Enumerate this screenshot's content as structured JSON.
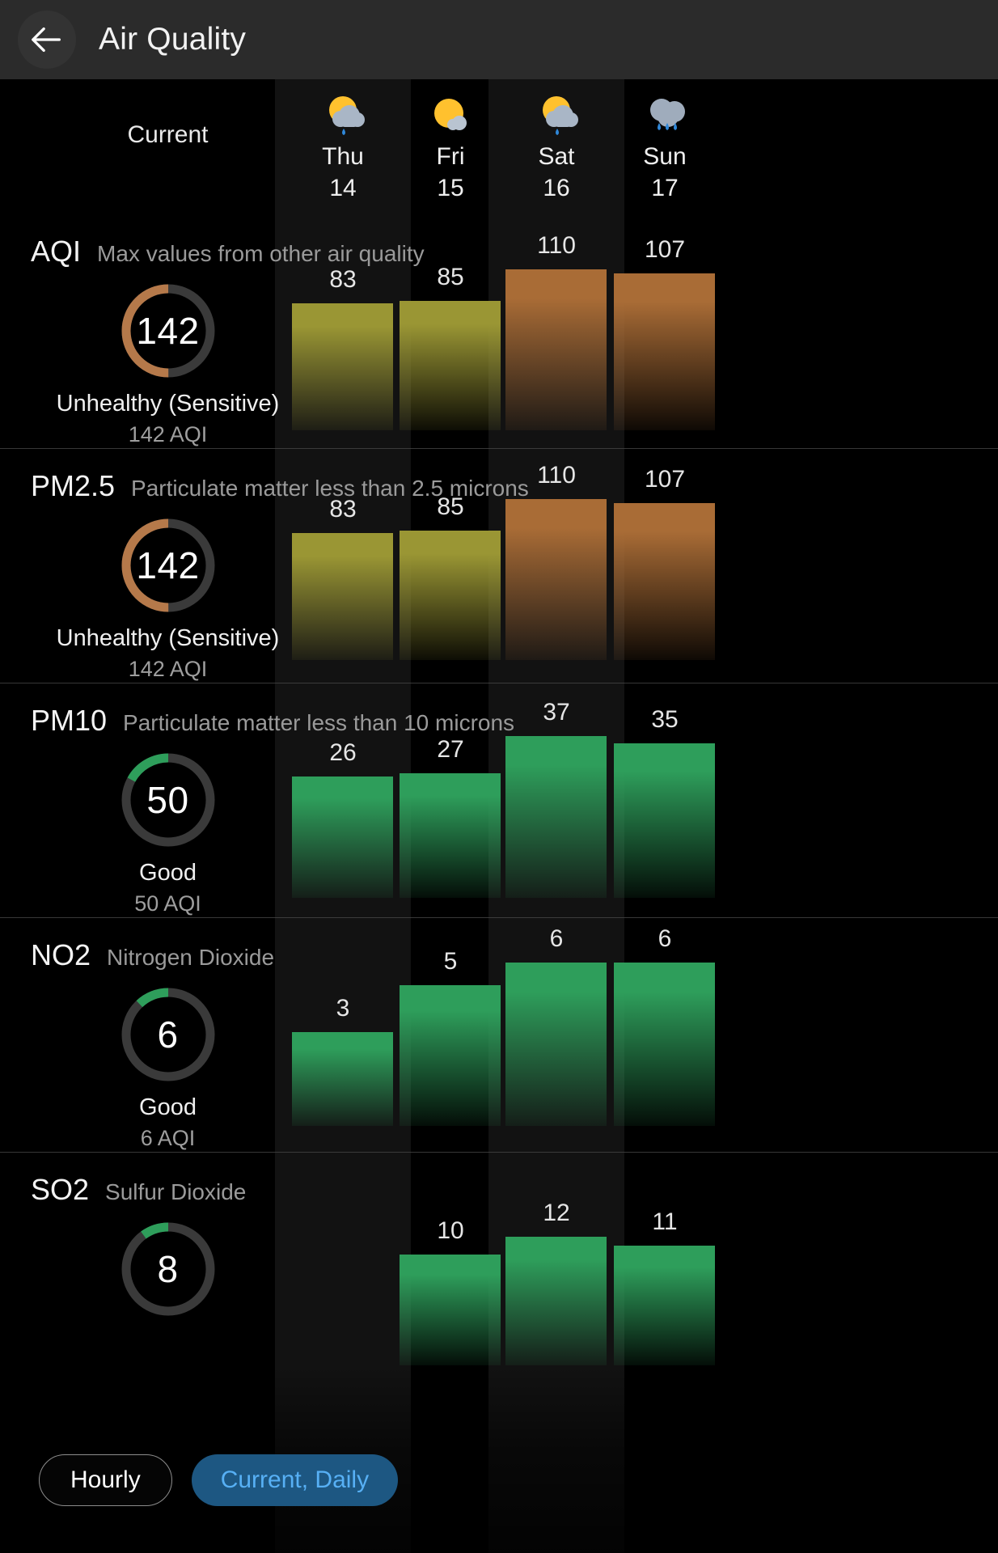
{
  "header": {
    "title": "Air Quality",
    "back_icon": "arrow-left-icon"
  },
  "days": {
    "current_label": "Current",
    "items": [
      {
        "name": "Thu",
        "date": "14",
        "icon": "sun-cloud-rain-icon"
      },
      {
        "name": "Fri",
        "date": "15",
        "icon": "sun-cloud-icon"
      },
      {
        "name": "Sat",
        "date": "16",
        "icon": "sun-cloud-rain-icon"
      },
      {
        "name": "Sun",
        "date": "17",
        "icon": "cloud-rain-icon"
      }
    ]
  },
  "footer": {
    "hourly_label": "Hourly",
    "current_daily_label": "Current, Daily"
  },
  "colors": {
    "accent_blue": "#57b0f5",
    "pill_blue_bg": "#1d5782",
    "brown": "#b5794a",
    "olive": "#9a9634",
    "green": "#2e9e5b",
    "track": "#3a3a3a",
    "column_bg": "#121212"
  },
  "chart_data": [
    {
      "type": "bar",
      "title": "AQI",
      "subtitle": "Max values from other air quality",
      "current": {
        "value": "142",
        "status": "Unhealthy (Sensitive)",
        "sub": "142 AQI",
        "ring_fraction": 0.5,
        "ring_color": "#b5794a"
      },
      "categories": [
        "Thu 14",
        "Fri 15",
        "Sat 16",
        "Sun 17"
      ],
      "values": [
        83,
        85,
        110,
        107
      ],
      "bar_colors": [
        "#9a9634",
        "#9a9634",
        "#a96c36",
        "#a96c36"
      ],
      "ylim": [
        0,
        150
      ]
    },
    {
      "type": "bar",
      "title": "PM2.5",
      "subtitle": "Particulate matter less than 2.5 microns",
      "current": {
        "value": "142",
        "status": "Unhealthy (Sensitive)",
        "sub": "142 AQI",
        "ring_fraction": 0.5,
        "ring_color": "#b5794a"
      },
      "categories": [
        "Thu 14",
        "Fri 15",
        "Sat 16",
        "Sun 17"
      ],
      "values": [
        83,
        85,
        110,
        107
      ],
      "bar_colors": [
        "#9a9634",
        "#9a9634",
        "#a96c36",
        "#a96c36"
      ],
      "ylim": [
        0,
        150
      ]
    },
    {
      "type": "bar",
      "title": "PM10",
      "subtitle": "Particulate matter less than 10 microns",
      "current": {
        "value": "50",
        "status": "Good",
        "sub": "50 AQI",
        "ring_fraction": 0.17,
        "ring_color": "#2e9e5b"
      },
      "categories": [
        "Thu 14",
        "Fri 15",
        "Sat 16",
        "Sun 17"
      ],
      "values": [
        26,
        27,
        37,
        35
      ],
      "bar_colors": [
        "#2e9e5b",
        "#2e9e5b",
        "#2e9e5b",
        "#2e9e5b"
      ],
      "ylim": [
        0,
        50
      ]
    },
    {
      "type": "bar",
      "title": "NO2",
      "subtitle": "Nitrogen Dioxide",
      "current": {
        "value": "6",
        "status": "Good",
        "sub": "6 AQI",
        "ring_fraction": 0.12,
        "ring_color": "#2e9e5b"
      },
      "categories": [
        "Thu 14",
        "Fri 15",
        "Sat 16",
        "Sun 17"
      ],
      "values": [
        3,
        5,
        6,
        6
      ],
      "bar_colors": [
        "#2e9e5b",
        "#2e9e5b",
        "#2e9e5b",
        "#2e9e5b"
      ],
      "ylim": [
        0,
        8
      ]
    },
    {
      "type": "bar",
      "title": "SO2",
      "subtitle": "Sulfur Dioxide",
      "current": {
        "value": "8",
        "status": "",
        "sub": "",
        "ring_fraction": 0.1,
        "ring_color": "#2e9e5b"
      },
      "categories": [
        "Thu 14",
        "Fri 15",
        "Sat 16",
        "Sun 17"
      ],
      "values": [
        null,
        10,
        12,
        11
      ],
      "bar_colors": [
        "#2e9e5b",
        "#2e9e5b",
        "#2e9e5b",
        "#2e9e5b"
      ],
      "ylim": [
        0,
        14
      ]
    }
  ]
}
